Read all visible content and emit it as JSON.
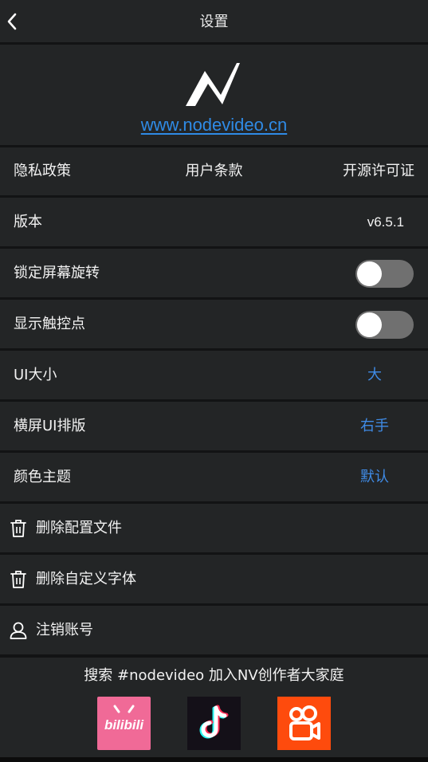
{
  "topbar": {
    "title": "设置",
    "back_icon": "chevron-left-icon"
  },
  "logo": {
    "icon": "nodevideo-logo-icon",
    "url_text": "www.nodevideo.cn"
  },
  "links": {
    "privacy": "隐私政策",
    "terms": "用户条款",
    "license": "开源许可证"
  },
  "settings": {
    "version": {
      "label": "版本",
      "value": "v6.5.1"
    },
    "lock_rotation": {
      "label": "锁定屏幕旋转",
      "enabled": false
    },
    "show_touches": {
      "label": "显示触控点",
      "enabled": false
    },
    "ui_size": {
      "label": "UI大小",
      "value": "大"
    },
    "landscape_layout": {
      "label": "横屏UI排版",
      "value": "右手"
    },
    "color_theme": {
      "label": "颜色主题",
      "value": "默认"
    }
  },
  "actions": {
    "delete_config": {
      "label": "删除配置文件",
      "icon": "trash-icon"
    },
    "delete_fonts": {
      "label": "删除自定义字体",
      "icon": "trash-icon"
    },
    "logout": {
      "label": "注销账号",
      "icon": "user-icon"
    }
  },
  "footer": {
    "text": "搜索 #nodevideo 加入NV创作者大家庭",
    "apps": [
      {
        "name": "bilibili",
        "icon": "bilibili-icon",
        "logo_text": "bilibili",
        "color": "#f06a97"
      },
      {
        "name": "tiktok",
        "icon": "tiktok-icon",
        "color": "#141018"
      },
      {
        "name": "kuaishou",
        "icon": "kuaishou-icon",
        "color": "#fe4b0d"
      }
    ]
  },
  "colors": {
    "background": "#121314",
    "panel": "#232526",
    "accent": "#3f8be6",
    "link": "#2f8be6",
    "toggle_off": "#707070"
  }
}
